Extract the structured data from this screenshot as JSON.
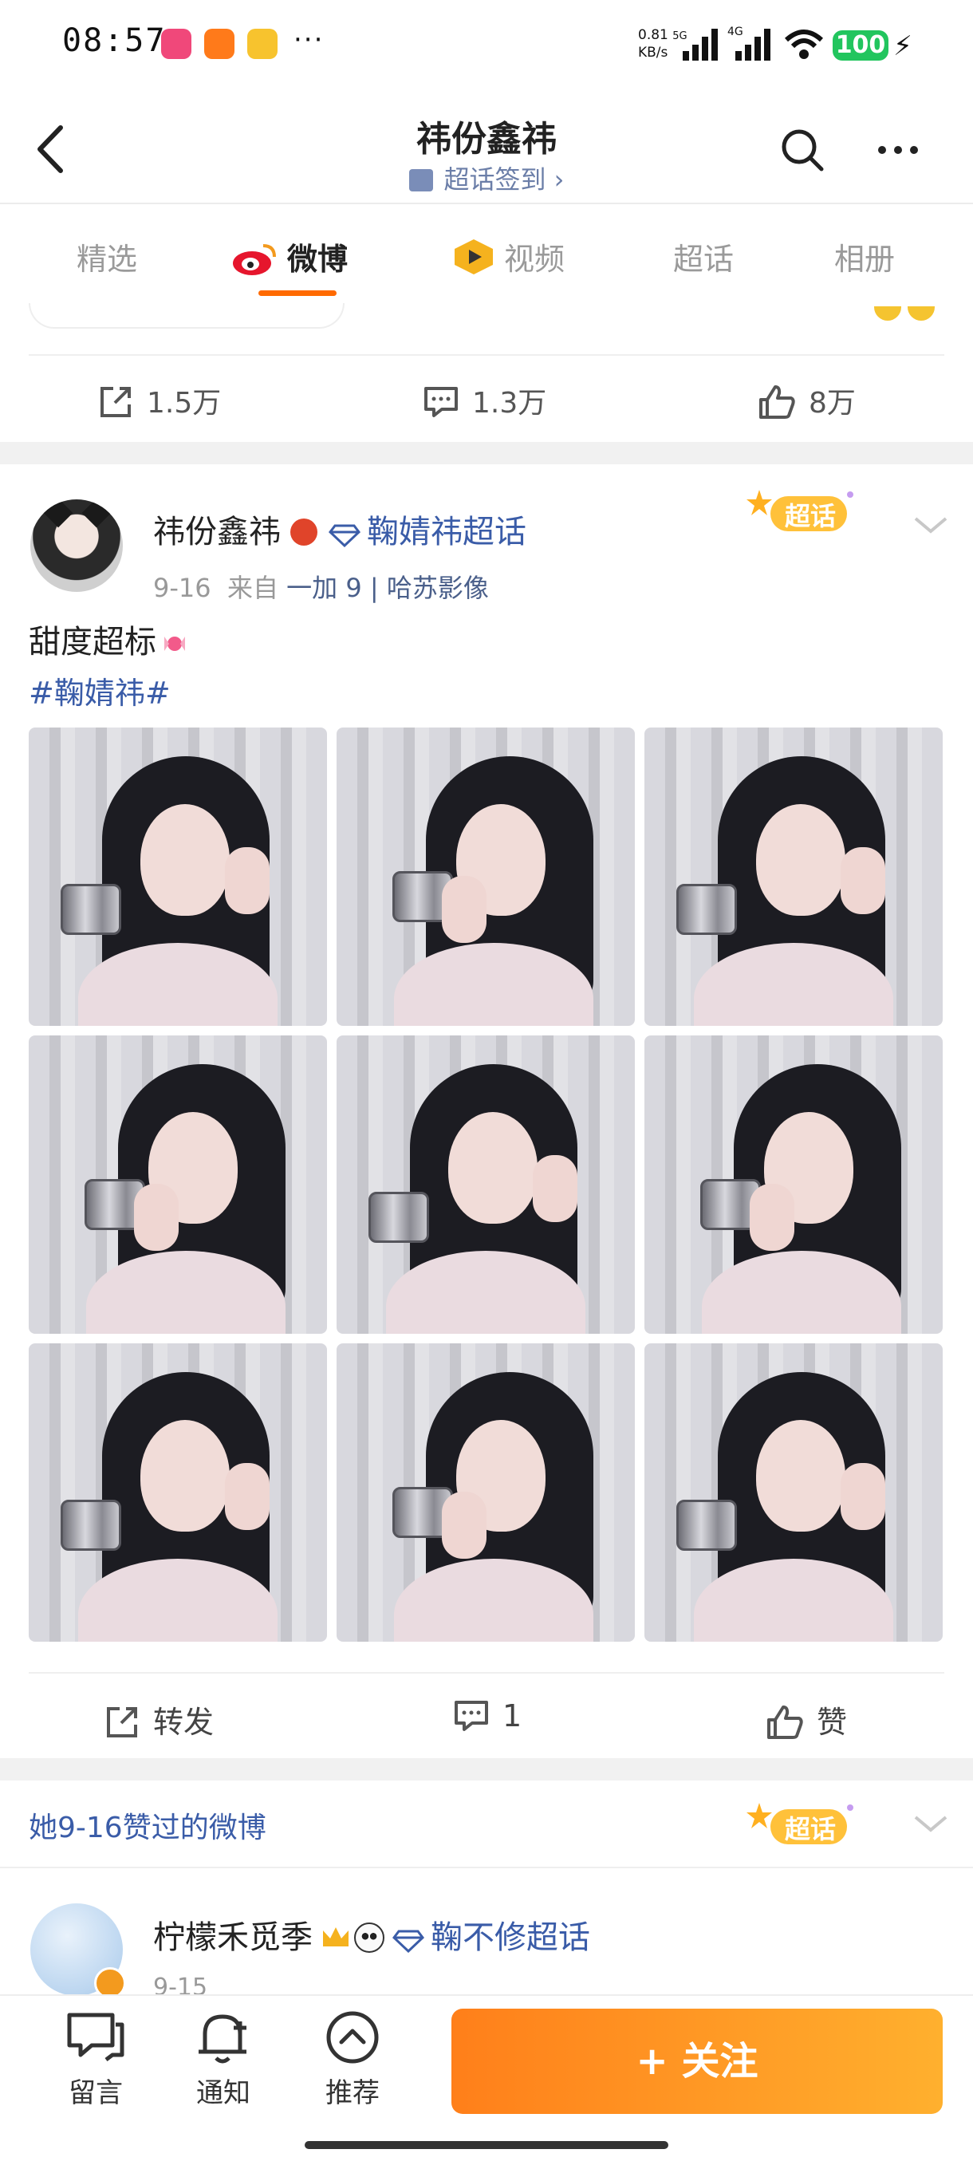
{
  "status_bar": {
    "time": "08:57",
    "net_speed_value": "0.81",
    "net_speed_unit": "KB/s",
    "net1": "5G",
    "net2": "4G",
    "battery": "100"
  },
  "header": {
    "title": "祎份鑫祎",
    "checkin_label": "超话签到 ›"
  },
  "tabs": [
    "精选",
    "微博",
    "视频",
    "超话",
    "相册"
  ],
  "prev_post": {
    "repost_count": "1.5万",
    "comment_count": "1.3万",
    "like_count": "8万"
  },
  "post": {
    "author": "祎份鑫祎",
    "topic": "鞠婧祎超话",
    "date": "9-16",
    "from_label": "来自",
    "source": "一加 9 | 哈苏影像",
    "text": "甜度超标",
    "hashtag": "#鞠婧祎#",
    "chaohua_tag": "超话",
    "actions": {
      "repost": "转发",
      "comment": "1",
      "like": "赞"
    }
  },
  "liked_header": {
    "text": "她9-16赞过的微博",
    "chaohua_tag": "超话"
  },
  "next_post": {
    "author": "柠檬禾觅季",
    "topic": "鞠不修超话",
    "date": "9-15"
  },
  "bottom_bar": {
    "comment": "留言",
    "notify": "通知",
    "recommend": "推荐",
    "follow": "+ 关注"
  },
  "colors": {
    "accent": "#ff7f1a",
    "link": "#3a5ca8",
    "tab_underline": "#ff6a00"
  }
}
